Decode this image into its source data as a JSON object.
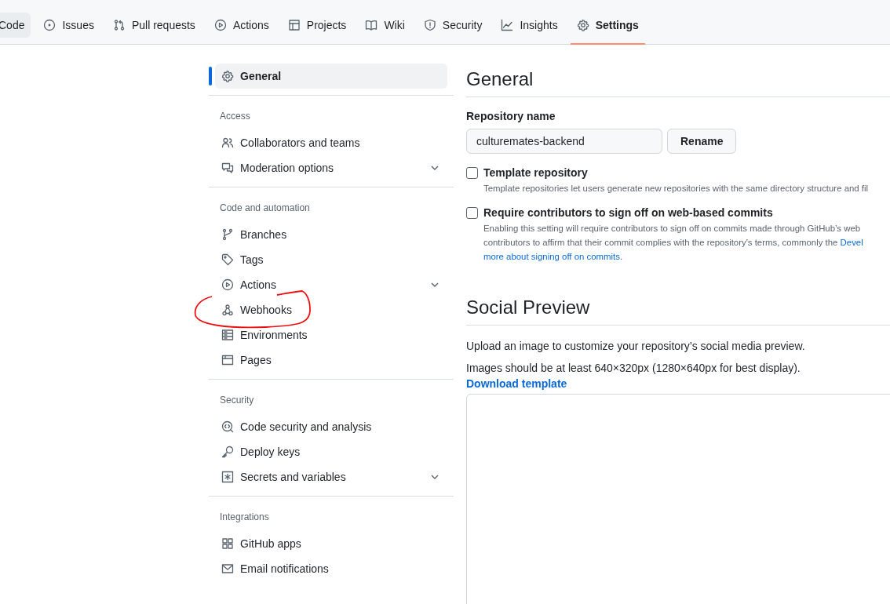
{
  "tabs": [
    {
      "label": "Code",
      "selected": false,
      "hovered": true
    },
    {
      "label": "Issues",
      "selected": false,
      "hovered": false
    },
    {
      "label": "Pull requests",
      "selected": false,
      "hovered": false
    },
    {
      "label": "Actions",
      "selected": false,
      "hovered": false
    },
    {
      "label": "Projects",
      "selected": false,
      "hovered": false
    },
    {
      "label": "Wiki",
      "selected": false,
      "hovered": false
    },
    {
      "label": "Security",
      "selected": false,
      "hovered": false
    },
    {
      "label": "Insights",
      "selected": false,
      "hovered": false
    },
    {
      "label": "Settings",
      "selected": true,
      "hovered": false
    }
  ],
  "sidebar": {
    "general": {
      "label": "General",
      "selected": true
    },
    "sections": [
      {
        "title": "Access",
        "items": [
          {
            "label": "Collaborators and teams",
            "expandable": false,
            "selected": false,
            "circled": false
          },
          {
            "label": "Moderation options",
            "expandable": true,
            "selected": false,
            "circled": false
          }
        ]
      },
      {
        "title": "Code and automation",
        "items": [
          {
            "label": "Branches",
            "expandable": false,
            "selected": false,
            "circled": false
          },
          {
            "label": "Tags",
            "expandable": false,
            "selected": false,
            "circled": false
          },
          {
            "label": "Actions",
            "expandable": true,
            "selected": false,
            "circled": false
          },
          {
            "label": "Webhooks",
            "expandable": false,
            "selected": false,
            "circled": true
          },
          {
            "label": "Environments",
            "expandable": false,
            "selected": false,
            "circled": false
          },
          {
            "label": "Pages",
            "expandable": false,
            "selected": false,
            "circled": false
          }
        ]
      },
      {
        "title": "Security",
        "items": [
          {
            "label": "Code security and analysis",
            "expandable": false,
            "selected": false,
            "circled": false
          },
          {
            "label": "Deploy keys",
            "expandable": false,
            "selected": false,
            "circled": false
          },
          {
            "label": "Secrets and variables",
            "expandable": true,
            "selected": false,
            "circled": false
          }
        ]
      },
      {
        "title": "Integrations",
        "items": [
          {
            "label": "GitHub apps",
            "expandable": false,
            "selected": false,
            "circled": false
          },
          {
            "label": "Email notifications",
            "expandable": false,
            "selected": false,
            "circled": false
          }
        ]
      }
    ]
  },
  "main": {
    "heading": "General",
    "repository_name": {
      "label": "Repository name",
      "value": "culturemates-backend",
      "button": "Rename"
    },
    "options": [
      {
        "title": "Template repository",
        "checked": false,
        "lines": [
          [
            {
              "text": "Template repositories let users generate new repositories with the same directory structure and fil",
              "link": false
            }
          ]
        ]
      },
      {
        "title": "Require contributors to sign off on web-based commits",
        "checked": false,
        "lines": [
          [
            {
              "text": "Enabling this setting will require contributors to sign off on commits made through GitHub’s web",
              "link": false
            }
          ],
          [
            {
              "text": "contributors to affirm that their commit complies with the repository's terms, commonly the ",
              "link": false
            },
            {
              "text": "Devel",
              "link": true
            }
          ],
          [
            {
              "text": "more about signing off on commits",
              "link": true
            },
            {
              "text": ".",
              "link": false
            }
          ]
        ]
      }
    ],
    "social_preview": {
      "heading": "Social Preview",
      "intro": "Upload an image to customize your repository’s social media preview.",
      "hint": "Images should be at least 640×320px (1280×640px for best display).",
      "link": "Download template"
    }
  }
}
